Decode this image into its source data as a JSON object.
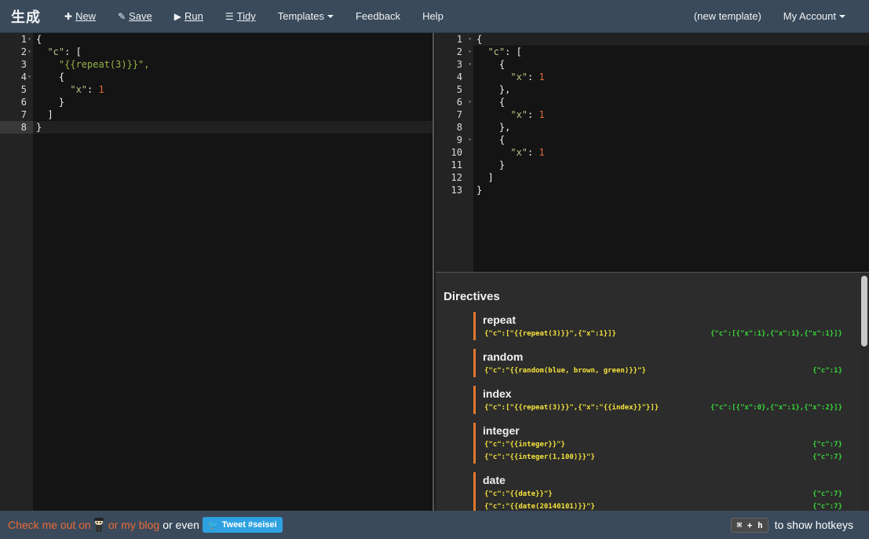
{
  "nav": {
    "brand": "生成",
    "items": [
      {
        "label": "New",
        "icon": "plus-icon"
      },
      {
        "label": "Save",
        "icon": "pencil-icon"
      },
      {
        "label": "Run",
        "icon": "play-icon"
      },
      {
        "label": "Tidy",
        "icon": "indent-icon"
      },
      {
        "label": "Templates",
        "icon": "caret-down-icon"
      },
      {
        "label": "Feedback"
      },
      {
        "label": "Help"
      }
    ],
    "template_name": "(new template)",
    "account": "My Account"
  },
  "left_editor": {
    "line_numbers": [
      "1",
      "2",
      "3",
      "4",
      "5",
      "6",
      "7",
      "8"
    ],
    "lines": [
      "{",
      "  \"c\": [",
      "    \"{{repeat(3)}}\",",
      "    {",
      "      \"x\": 1",
      "    }",
      "  ]",
      "}"
    ]
  },
  "right_editor": {
    "line_numbers": [
      "1",
      "2",
      "3",
      "4",
      "5",
      "6",
      "7",
      "8",
      "9",
      "10",
      "11",
      "12",
      "13"
    ],
    "lines": [
      "{",
      "  \"c\": [",
      "    {",
      "      \"x\": 1",
      "    },",
      "    {",
      "      \"x\": 1",
      "    },",
      "    {",
      "      \"x\": 1",
      "    }",
      "  ]",
      "}"
    ]
  },
  "directives": {
    "title": "Directives",
    "items": [
      {
        "name": "repeat",
        "rows": [
          {
            "input": "{\"c\":[\"{{repeat(3)}}\",{\"x\":1}]}",
            "output": "{\"c\":[{\"x\":1},{\"x\":1},{\"x\":1}]}"
          }
        ]
      },
      {
        "name": "random",
        "rows": [
          {
            "input": "{\"c\":\"{{random(blue, brown, green)}}\"}",
            "output": "{\"c\":1}"
          }
        ]
      },
      {
        "name": "index",
        "rows": [
          {
            "input": "{\"c\":[\"{{repeat(3)}}\",{\"x\":\"{{index}}\"}]}",
            "output": "{\"c\":[{\"x\":0},{\"x\":1},{\"x\":2}]}"
          }
        ]
      },
      {
        "name": "integer",
        "rows": [
          {
            "input": "{\"c\":\"{{integer}}\"}",
            "output": "{\"c\":7}"
          },
          {
            "input": "{\"c\":\"{{integer(1,100)}}\"}",
            "output": "{\"c\":7}"
          }
        ]
      },
      {
        "name": "date",
        "rows": [
          {
            "input": "{\"c\":\"{{date}}\"}",
            "output": "{\"c\":7}"
          },
          {
            "input": "{\"c\":\"{{date(20140101)}}\"}",
            "output": "{\"c\":7}"
          }
        ]
      }
    ]
  },
  "footer": {
    "link_github": "Check me out on",
    "link_blog": "or my blog",
    "text_even": "or even",
    "tweet_label": "Tweet #seisei",
    "hotkey": "⌘ + h",
    "hotkey_text": "to show hotkeys"
  },
  "colors": {
    "topbar": "#3a4a5b",
    "accent_orange": "#e96a36",
    "directive_input": "#f5e33b",
    "directive_output": "#38d83a",
    "tweet_blue": "#2ea2e0"
  }
}
